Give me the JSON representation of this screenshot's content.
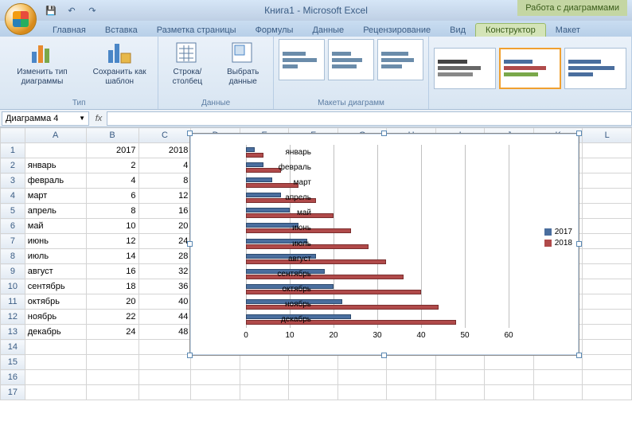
{
  "app": {
    "title": "Книга1 - Microsoft Excel",
    "chart_tools_label": "Работа с диаграммами"
  },
  "qat": {
    "save": "💾",
    "undo": "↶",
    "redo": "↷"
  },
  "tabs": {
    "items": [
      "Главная",
      "Вставка",
      "Разметка страницы",
      "Формулы",
      "Данные",
      "Рецензирование",
      "Вид",
      "Конструктор",
      "Макет"
    ],
    "active": "Конструктор"
  },
  "ribbon": {
    "group_type": "Тип",
    "change_type": "Изменить тип диаграммы",
    "save_template": "Сохранить как шаблон",
    "group_data": "Данные",
    "switch_rc": "Строка/столбец",
    "select_data": "Выбрать данные",
    "group_layouts": "Макеты диаграмм"
  },
  "namebox": {
    "value": "Диаграмма 4"
  },
  "columns": [
    "A",
    "B",
    "C",
    "D",
    "E",
    "F",
    "G",
    "H",
    "I",
    "J",
    "K",
    "L"
  ],
  "rows": {
    "header": {
      "b": "2017",
      "c": "2018"
    },
    "data": [
      {
        "a": "январь",
        "b": "2",
        "c": "4"
      },
      {
        "a": "февраль",
        "b": "4",
        "c": "8"
      },
      {
        "a": "март",
        "b": "6",
        "c": "12"
      },
      {
        "a": "апрель",
        "b": "8",
        "c": "16"
      },
      {
        "a": "май",
        "b": "10",
        "c": "20"
      },
      {
        "a": "июнь",
        "b": "12",
        "c": "24"
      },
      {
        "a": "июль",
        "b": "14",
        "c": "28"
      },
      {
        "a": "август",
        "b": "16",
        "c": "32"
      },
      {
        "a": "сентябрь",
        "b": "18",
        "c": "36"
      },
      {
        "a": "октябрь",
        "b": "20",
        "c": "40"
      },
      {
        "a": "ноябрь",
        "b": "22",
        "c": "44"
      },
      {
        "a": "декабрь",
        "b": "24",
        "c": "48"
      }
    ]
  },
  "chart_data": {
    "type": "bar",
    "categories": [
      "январь",
      "февраль",
      "март",
      "апрель",
      "май",
      "июнь",
      "июль",
      "август",
      "сентябрь",
      "октябрь",
      "ноябрь",
      "декабрь"
    ],
    "series": [
      {
        "name": "2017",
        "values": [
          2,
          4,
          6,
          8,
          10,
          12,
          14,
          16,
          18,
          20,
          22,
          24
        ],
        "color": "#4a6e9e"
      },
      {
        "name": "2018",
        "values": [
          4,
          8,
          12,
          16,
          20,
          24,
          28,
          32,
          36,
          40,
          44,
          48
        ],
        "color": "#b04a4a"
      }
    ],
    "xlim": [
      0,
      60
    ],
    "xticks": [
      0,
      10,
      20,
      30,
      40,
      50,
      60
    ],
    "legend_position": "right"
  }
}
